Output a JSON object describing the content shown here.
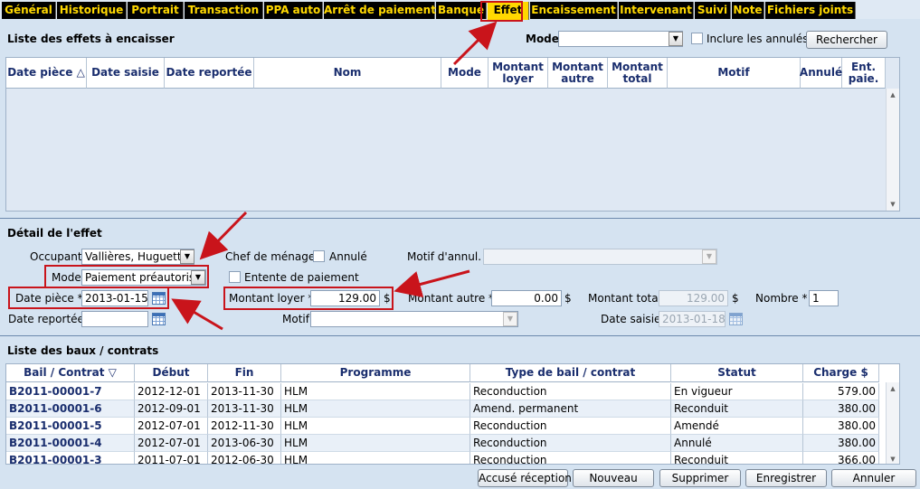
{
  "tabs": [
    "Général",
    "Historique",
    "Portrait",
    "Transaction",
    "PPA auto",
    "Arrêt de paiement",
    "Banque",
    "Effet",
    "Encaissement",
    "Intervenant",
    "Suivi",
    "Note",
    "Fichiers joints"
  ],
  "active_tab": "Effet",
  "effets": {
    "title": "Liste des effets à encaisser",
    "mode_label": "Mode",
    "mode_value": "",
    "include_label": "Inclure les annulés",
    "search_button": "Rechercher",
    "columns": [
      "Date pièce △",
      "Date saisie",
      "Date reportée",
      "Nom",
      "Mode",
      "Montant loyer",
      "Montant autre",
      "Montant total",
      "Motif",
      "Annulé",
      "Ent. paie."
    ],
    "rows": []
  },
  "detail": {
    "title": "Détail de l'effet",
    "occupant_label": "Occupant",
    "occupant_value": "Vallières, Huguette",
    "chef_label": "Chef de ménage",
    "annule_label": "Annulé",
    "motif_annul_label": "Motif d'annul.",
    "motif_annul_value": "",
    "mode_label": "Mode",
    "mode_value": "Paiement préautorisé",
    "entente_label": "Entente de paiement",
    "date_piece_label": "Date pièce *",
    "date_piece_value": "2013-01-15",
    "montant_loyer_label": "Montant loyer *",
    "montant_loyer_value": "129.00",
    "currency": "$",
    "montant_autre_label": "Montant autre *",
    "montant_autre_value": "0.00",
    "montant_total_label": "Montant total",
    "montant_total_value": "129.00",
    "nombre_label": "Nombre *",
    "nombre_value": "1",
    "date_reportee_label": "Date reportée",
    "date_reportee_value": "",
    "motif_label": "Motif",
    "motif_value": "",
    "date_saisie_label": "Date saisie",
    "date_saisie_value": "2013-01-18"
  },
  "baux": {
    "title": "Liste des baux / contrats",
    "columns": [
      "Bail / Contrat ▽",
      "Début",
      "Fin",
      "Programme",
      "Type de bail / contrat",
      "Statut",
      "Charge $"
    ],
    "rows": [
      [
        "B2011-00001-7",
        "2012-12-01",
        "2013-11-30",
        "HLM",
        "Reconduction",
        "En vigueur",
        "579.00"
      ],
      [
        "B2011-00001-6",
        "2012-09-01",
        "2013-11-30",
        "HLM",
        "Amend. permanent",
        "Reconduit",
        "380.00"
      ],
      [
        "B2011-00001-5",
        "2012-07-01",
        "2012-11-30",
        "HLM",
        "Reconduction",
        "Amendé",
        "380.00"
      ],
      [
        "B2011-00001-4",
        "2012-07-01",
        "2013-06-30",
        "HLM",
        "Reconduction",
        "Annulé",
        "380.00"
      ],
      [
        "B2011-00001-3",
        "2011-07-01",
        "2012-06-30",
        "HLM",
        "Reconduction",
        "Reconduit",
        "366.00"
      ]
    ]
  },
  "footer": {
    "accuse": "Accusé réception",
    "nouveau": "Nouveau",
    "supprimer": "Supprimer",
    "enregistrer": "Enregistrer",
    "annuler": "Annuler"
  },
  "colors": {
    "tab_bg": "#000000",
    "tab_text": "#ffd800",
    "highlight": "#c9141b",
    "link": "#1a2e6e"
  }
}
